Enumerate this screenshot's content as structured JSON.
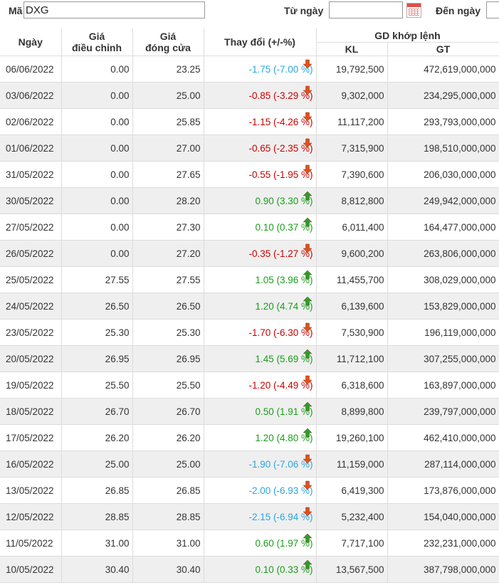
{
  "filter": {
    "ma_label": "Mã",
    "ma_value": "DXG",
    "tu_ngay_label": "Từ ngày",
    "tu_ngay_value": "",
    "den_ngay_label": "Đến ngày",
    "den_ngay_value": ""
  },
  "table": {
    "headers": {
      "date": "Ngày",
      "adj_price_1": "Giá",
      "adj_price_2": "điều chỉnh",
      "close_price_1": "Giá",
      "close_price_2": "đóng cửa",
      "change": "Thay đổi (+/-%)",
      "matched": "GD khớp lệnh",
      "kl": "KL",
      "gt": "GT"
    },
    "rows": [
      {
        "date": "06/06/2022",
        "adj": "0.00",
        "close": "23.25",
        "change": "-1.75 (-7.00 %)",
        "dir": "floor",
        "kl": "19,792,500",
        "gt": "472,619,000,000"
      },
      {
        "date": "03/06/2022",
        "adj": "0.00",
        "close": "25.00",
        "change": "-0.85 (-3.29 %)",
        "dir": "down",
        "kl": "9,302,000",
        "gt": "234,295,000,000"
      },
      {
        "date": "02/06/2022",
        "adj": "0.00",
        "close": "25.85",
        "change": "-1.15 (-4.26 %)",
        "dir": "down",
        "kl": "11,117,200",
        "gt": "293,793,000,000"
      },
      {
        "date": "01/06/2022",
        "adj": "0.00",
        "close": "27.00",
        "change": "-0.65 (-2.35 %)",
        "dir": "down",
        "kl": "7,315,900",
        "gt": "198,510,000,000"
      },
      {
        "date": "31/05/2022",
        "adj": "0.00",
        "close": "27.65",
        "change": "-0.55 (-1.95 %)",
        "dir": "down",
        "kl": "7,390,600",
        "gt": "206,030,000,000"
      },
      {
        "date": "30/05/2022",
        "adj": "0.00",
        "close": "28.20",
        "change": "0.90 (3.30 %)",
        "dir": "up",
        "kl": "8,812,800",
        "gt": "249,942,000,000"
      },
      {
        "date": "27/05/2022",
        "adj": "0.00",
        "close": "27.30",
        "change": "0.10 (0.37 %)",
        "dir": "up",
        "kl": "6,011,400",
        "gt": "164,477,000,000"
      },
      {
        "date": "26/05/2022",
        "adj": "0.00",
        "close": "27.20",
        "change": "-0.35 (-1.27 %)",
        "dir": "down",
        "kl": "9,600,200",
        "gt": "263,806,000,000"
      },
      {
        "date": "25/05/2022",
        "adj": "27.55",
        "close": "27.55",
        "change": "1.05 (3.96 %)",
        "dir": "up",
        "kl": "11,455,700",
        "gt": "308,029,000,000"
      },
      {
        "date": "24/05/2022",
        "adj": "26.50",
        "close": "26.50",
        "change": "1.20 (4.74 %)",
        "dir": "up",
        "kl": "6,139,600",
        "gt": "153,829,000,000"
      },
      {
        "date": "23/05/2022",
        "adj": "25.30",
        "close": "25.30",
        "change": "-1.70 (-6.30 %)",
        "dir": "down",
        "kl": "7,530,900",
        "gt": "196,119,000,000"
      },
      {
        "date": "20/05/2022",
        "adj": "26.95",
        "close": "26.95",
        "change": "1.45 (5.69 %)",
        "dir": "up",
        "kl": "11,712,100",
        "gt": "307,255,000,000"
      },
      {
        "date": "19/05/2022",
        "adj": "25.50",
        "close": "25.50",
        "change": "-1.20 (-4.49 %)",
        "dir": "down",
        "kl": "6,318,600",
        "gt": "163,897,000,000"
      },
      {
        "date": "18/05/2022",
        "adj": "26.70",
        "close": "26.70",
        "change": "0.50 (1.91 %)",
        "dir": "up",
        "kl": "8,899,800",
        "gt": "239,797,000,000"
      },
      {
        "date": "17/05/2022",
        "adj": "26.20",
        "close": "26.20",
        "change": "1.20 (4.80 %)",
        "dir": "up",
        "kl": "19,260,100",
        "gt": "462,410,000,000"
      },
      {
        "date": "16/05/2022",
        "adj": "25.00",
        "close": "25.00",
        "change": "-1.90 (-7.06 %)",
        "dir": "floor",
        "kl": "11,159,000",
        "gt": "287,114,000,000"
      },
      {
        "date": "13/05/2022",
        "adj": "26.85",
        "close": "26.85",
        "change": "-2.00 (-6.93 %)",
        "dir": "floor",
        "kl": "6,419,300",
        "gt": "173,876,000,000"
      },
      {
        "date": "12/05/2022",
        "adj": "28.85",
        "close": "28.85",
        "change": "-2.15 (-6.94 %)",
        "dir": "floor",
        "kl": "5,232,400",
        "gt": "154,040,000,000"
      },
      {
        "date": "11/05/2022",
        "adj": "31.00",
        "close": "31.00",
        "change": "0.60 (1.97 %)",
        "dir": "up",
        "kl": "7,717,100",
        "gt": "232,231,000,000"
      },
      {
        "date": "10/05/2022",
        "adj": "30.40",
        "close": "30.40",
        "change": "0.10 (0.33 %)",
        "dir": "up",
        "kl": "13,567,500",
        "gt": "387,798,000,000"
      }
    ]
  },
  "colors": {
    "down": "#cc0000",
    "up": "#1a9e1a",
    "floor": "#2aa6e0",
    "row_alt": "#efefef",
    "arrow_down": "#e0501a",
    "arrow_up": "#2a9e2a"
  }
}
